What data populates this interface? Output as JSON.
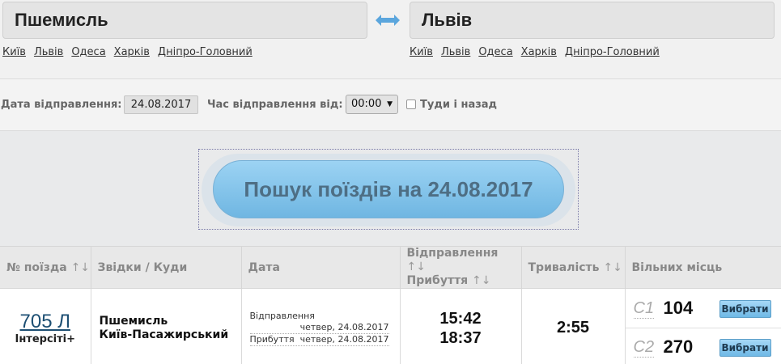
{
  "stations": {
    "from": "Пшемисль",
    "to": "Львів",
    "quick_from": [
      "Київ",
      "Львів",
      "Одеса",
      "Харків",
      "Дніпро-Головний"
    ],
    "quick_to": [
      "Київ",
      "Львів",
      "Одеса",
      "Харків",
      "Дніпро-Головний"
    ]
  },
  "dateline": {
    "date_label": "Дата відправлення:",
    "date_value": "24.08.2017",
    "time_label": "Час відправлення від:",
    "time_value": "00:00",
    "roundtrip_label": "Туди і назад"
  },
  "search": {
    "label": "Пошук поїздів на 24.08.2017"
  },
  "table": {
    "headers": {
      "train": "№ поїзда",
      "route": "Звідки / Куди",
      "date": "Дата",
      "depart": "Відправлення",
      "arrive": "Прибуття",
      "duration": "Тривалість",
      "seats": "Вільних місць",
      "sort_glyph": "↑↓"
    },
    "rows": [
      {
        "number": "705 Л",
        "type": "Інтерсіті+",
        "from": "Пшемисль",
        "to": "Київ-Пасажирський",
        "depart_label": "Відправлення",
        "depart_date": "четвер, 24.08.2017",
        "arrive_label": "Прибуття",
        "arrive_date": "четвер, 24.08.2017",
        "depart_time": "15:42",
        "arrive_time": "18:37",
        "duration": "2:55",
        "seats": [
          {
            "class": "С1",
            "count": "104",
            "button": "Вибрати"
          },
          {
            "class": "С2",
            "count": "270",
            "button": "Вибрати"
          }
        ]
      }
    ]
  },
  "colors": {
    "accent": "#6fb6e2",
    "link": "#1d4f73"
  }
}
